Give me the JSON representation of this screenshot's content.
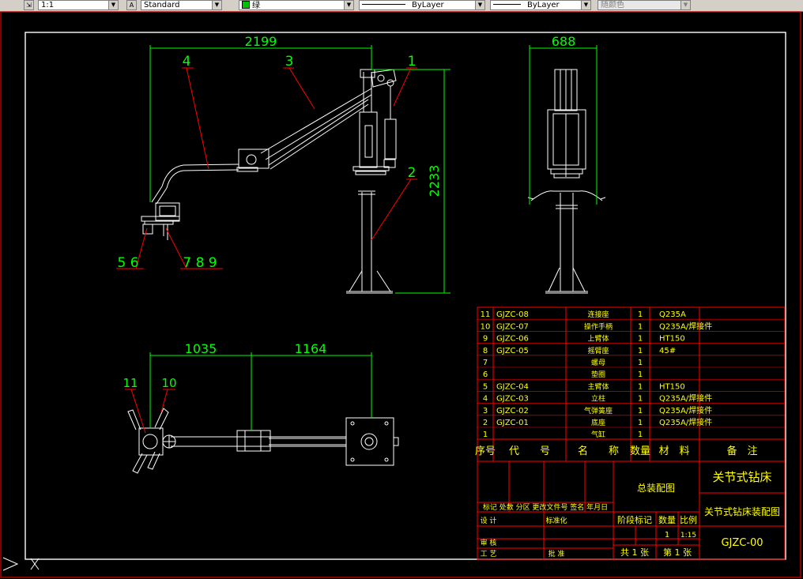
{
  "toolbar": {
    "scale_value": "1:1",
    "text_style": "Standard",
    "color_label": "绿",
    "linetype": "ByLayer",
    "lineweight": "ByLayer",
    "plot_style": "随颜色"
  },
  "dims": {
    "d2199": "2199",
    "d688": "688",
    "d2233": "2233",
    "d1035": "1035",
    "d1164": "1164"
  },
  "balloons": {
    "b1": "1",
    "b2": "2",
    "b3": "3",
    "b4": "4",
    "b56": "5 6",
    "b789": "7 8 9",
    "b10": "10",
    "b11": "11"
  },
  "bom": {
    "rows": [
      {
        "no": "11",
        "code": "GJZC-08",
        "name": "连接座",
        "qty": "1",
        "mat": "Q235A"
      },
      {
        "no": "10",
        "code": "GJZC-07",
        "name": "操作手柄",
        "qty": "1",
        "mat": "Q235A/焊接件"
      },
      {
        "no": "9",
        "code": "GJZC-06",
        "name": "上臂体",
        "qty": "1",
        "mat": "HT150"
      },
      {
        "no": "8",
        "code": "GJZC-05",
        "name": "摇臂座",
        "qty": "1",
        "mat": "45#"
      },
      {
        "no": "7",
        "code": "",
        "name": "螺母",
        "qty": "1",
        "mat": ""
      },
      {
        "no": "6",
        "code": "",
        "name": "垫圈",
        "qty": "1",
        "mat": ""
      },
      {
        "no": "5",
        "code": "GJZC-04",
        "name": "主臂体",
        "qty": "1",
        "mat": "HT150"
      },
      {
        "no": "4",
        "code": "GJZC-03",
        "name": "立柱",
        "qty": "1",
        "mat": "Q235A/焊接件"
      },
      {
        "no": "3",
        "code": "GJZC-02",
        "name": "气弹簧座",
        "qty": "1",
        "mat": "Q235A/焊接件"
      },
      {
        "no": "2",
        "code": "GJZC-01",
        "name": "底座",
        "qty": "1",
        "mat": "Q235A/焊接件"
      },
      {
        "no": "1",
        "code": "",
        "name": "气缸",
        "qty": "1",
        "mat": ""
      }
    ],
    "header": {
      "no": "序号",
      "code": "代　　号",
      "name": "名　　称",
      "qty": "数量",
      "mat": "材　料",
      "remark": "备　注"
    }
  },
  "title_block": {
    "title": "关节式钻床",
    "drawing_name": "关节式钻床装配图",
    "drawing_no": "GJZC-00",
    "center_label": "总装配图",
    "revision_row": "标记 处数 分区 更改文件号 签名 年月日",
    "design": "设 计",
    "standard": "标准化",
    "review": "审 核",
    "process": "工 艺",
    "approve": "批 准",
    "stage_mark": "阶段标记",
    "weight": "数量",
    "scale_label": "比例",
    "qty_value": "1",
    "scale_value": "1:15",
    "sheets": "共 1 张",
    "sheet_no": "第 1 张"
  },
  "colors": {
    "frame": "#ffffff",
    "dim": "#00ff00",
    "balloon_leader": "#ff0000",
    "outer_border": "#ff0000",
    "table_text": "#ffff00",
    "table_green": "#00ff00"
  }
}
